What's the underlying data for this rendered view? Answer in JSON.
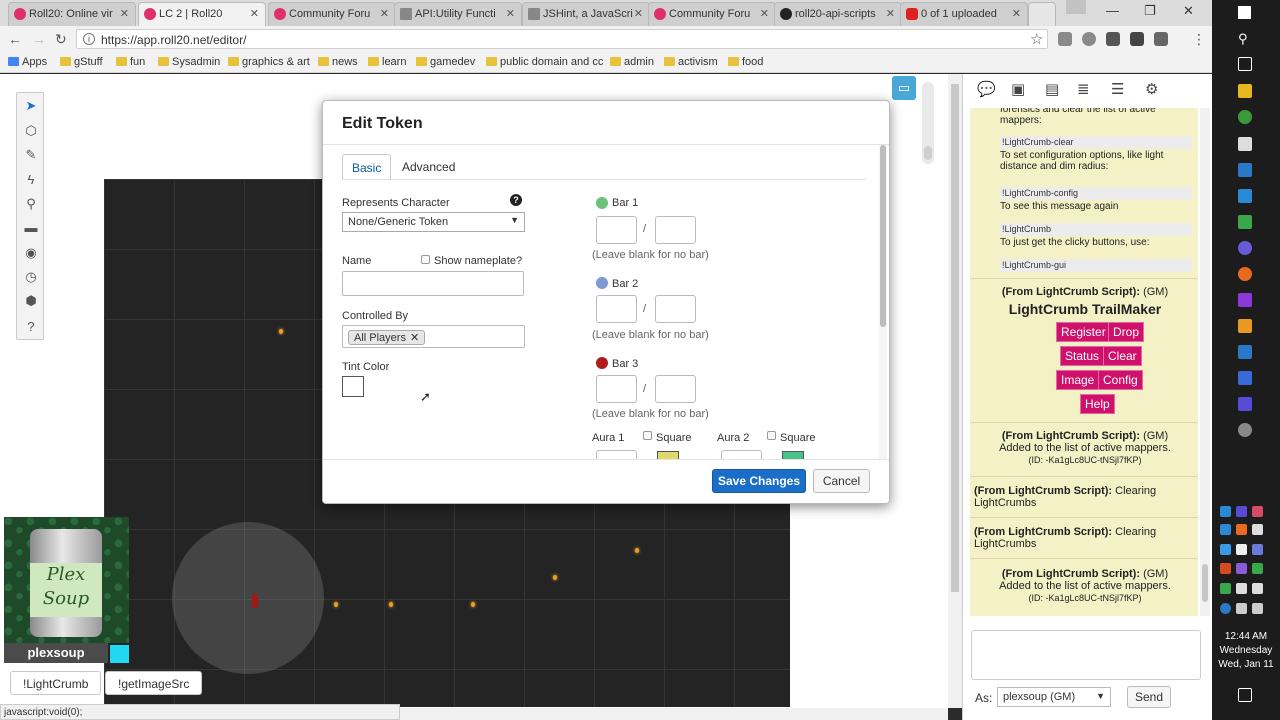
{
  "browser": {
    "tabs": [
      {
        "title": "Roll20: Online vir",
        "favicon_color": "#e0306a"
      },
      {
        "title": "LC 2 | Roll20",
        "favicon_color": "#e0306a"
      },
      {
        "title": "Community Foru",
        "favicon_color": "#e0306a"
      },
      {
        "title": "API:Utility Functi",
        "favicon_color": "#888888"
      },
      {
        "title": "JSHint, a JavaScri",
        "favicon_color": "#888888"
      },
      {
        "title": "Community Foru",
        "favicon_color": "#e0306a"
      },
      {
        "title": "roll20-api-scripts",
        "favicon_color": "#222222"
      },
      {
        "title": "0 of 1 uploaded",
        "favicon_color": "#e02020"
      }
    ],
    "url": "https://app.roll20.net/editor/",
    "bookmarks": [
      "Apps",
      "gStuff",
      "fun",
      "Sysadmin",
      "graphics & art",
      "news",
      "learn",
      "gamedev",
      "public domain and cc",
      "admin",
      "activism",
      "food"
    ]
  },
  "dialog": {
    "title": "Edit Token",
    "tabs": [
      "Basic",
      "Advanced"
    ],
    "represents_label": "Represents Character",
    "represents_value": "None/Generic Token",
    "name_label": "Name",
    "show_nameplate": "Show nameplate?",
    "controlled_label": "Controlled By",
    "controlled_chip": "All Players",
    "tint_label": "Tint Color",
    "bars": [
      {
        "label": "Bar 1",
        "color": "#6cc27a",
        "hint": "(Leave blank for no bar)"
      },
      {
        "label": "Bar 2",
        "color": "#7a9ad0",
        "hint": "(Leave blank for no bar)"
      },
      {
        "label": "Bar 3",
        "color": "#b01c1c",
        "hint": "(Leave blank for no bar)"
      }
    ],
    "slash": "/",
    "aura1": "Aura 1",
    "aura2": "Aura 2",
    "square": "Square",
    "save": "Save Changes",
    "cancel": "Cancel"
  },
  "player": {
    "name": "plexsoup",
    "can_text": "Plex Soup",
    "color": "#22d8f0",
    "macros": [
      "!LightCrumb",
      "!getImageSrc"
    ]
  },
  "statusbar": "javascript:void(0);",
  "chat": {
    "intro_text": "forensics and clear the list of active mappers:",
    "items": [
      {
        "cmd": "!LightCrumb-clear",
        "desc": "To set configuration options, like light distance and dim radius:"
      },
      {
        "cmd": "!LightCrumb-config",
        "desc": "To see this message again"
      },
      {
        "cmd": "!LightCrumb",
        "desc": "To just get the clicky buttons, use:"
      },
      {
        "cmd": "!LightCrumb-gui",
        "desc": ""
      }
    ],
    "from": "(From LightCrumb Script):",
    "gm": "(GM)",
    "trailmaker": "LightCrumb TrailMaker",
    "buttons": [
      "Register",
      "Drop",
      "Status",
      "Clear",
      "Image",
      "Config",
      "Help"
    ],
    "messages": [
      {
        "text": "Added to the list of active mappers.",
        "id": "(ID: -Ka1gLc8UC-tNSjl7fKP)"
      },
      {
        "text": "Clearing LightCrumbs",
        "id": ""
      },
      {
        "text": "Clearing LightCrumbs",
        "id": ""
      },
      {
        "text": "Added to the list of active mappers.",
        "id": "(ID: -Ka1gLc8UC-tNSjl7fKP)"
      }
    ],
    "as_label": "As:",
    "as_value": "plexsoup (GM)",
    "send": "Send"
  },
  "clock": {
    "time": "12:44 AM",
    "day": "Wednesday",
    "date": "Wed, Jan 11"
  },
  "accent_colors": {
    "macro_button": "#d0116b",
    "save_button": "#1a6ec8",
    "chat_bg": "#f3f1c5"
  }
}
